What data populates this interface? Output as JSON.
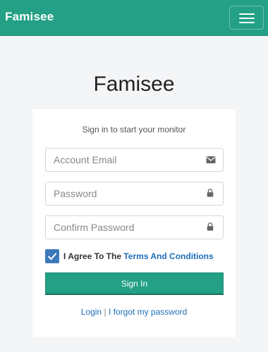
{
  "navbar": {
    "brand": "Famisee",
    "menu_icon": "hamburger-menu-icon"
  },
  "page": {
    "title": "Famisee"
  },
  "form": {
    "message": "Sign in to start your monitor",
    "email_placeholder": "Account Email",
    "email_icon": "envelope-icon",
    "password_placeholder": "Password",
    "password_icon": "lock-icon",
    "confirm_placeholder": "Confirm Password",
    "confirm_icon": "lock-icon",
    "agree_checked": true,
    "agree_prefix": "I Agree To The",
    "terms_link": "Terms And Conditions",
    "signin_label": "Sign In",
    "login_link": "Login",
    "separator": "|",
    "forgot_link": "I forgot my password"
  },
  "colors": {
    "primary": "#23a085",
    "link": "#1f6fb8",
    "checkbox": "#3c79bb",
    "background": "#f4f5f7"
  }
}
